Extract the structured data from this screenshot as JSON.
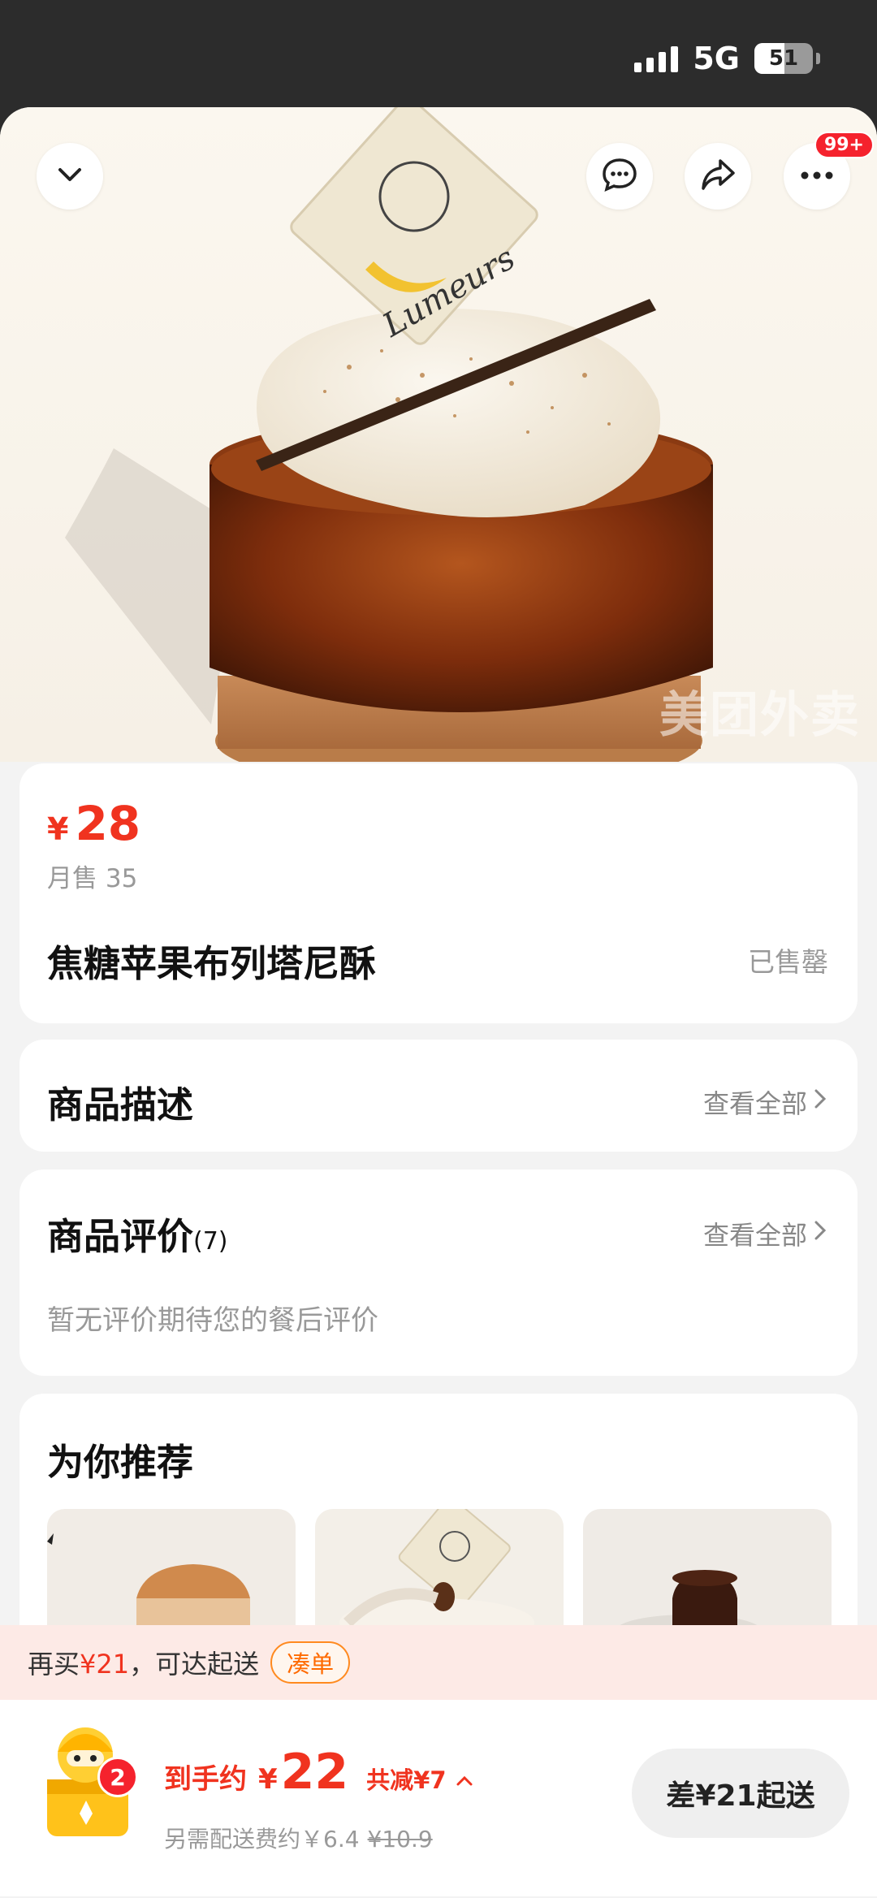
{
  "status_bar": {
    "network": "5G",
    "battery": "51",
    "battery_level": 0.51
  },
  "header": {
    "more_badge": "99+",
    "icons": [
      "chevron-down-icon",
      "chat-icon",
      "share-icon",
      "more-icon"
    ]
  },
  "hero": {
    "watermark": "美团外卖"
  },
  "product": {
    "price_symbol": "¥",
    "price": "28",
    "monthly_sales": "月售 35",
    "name": "焦糖苹果布列塔尼酥",
    "status": "已售罄"
  },
  "description_section": {
    "title": "商品描述",
    "see_all": "查看全部"
  },
  "reviews_section": {
    "title": "商品评价",
    "count": "(7)",
    "see_all": "查看全部",
    "empty_text": "暂无评价期待您的餐后评价"
  },
  "recommend_section": {
    "title": "为你推荐"
  },
  "min_order_bar": {
    "prefix": "再买",
    "amount": "¥21",
    "suffix": "，可达起送",
    "button": "凑单"
  },
  "cart": {
    "count": "2",
    "estimate_label": "到手约",
    "estimate_symbol": "¥",
    "estimate_price": "22",
    "discount": "共减¥7",
    "fee_text": "另需配送费约￥6.4",
    "original_price": "¥10.9",
    "checkout_label": "差¥21起送"
  },
  "colors": {
    "accent_red": "#f0331f",
    "orange": "#ff6a00",
    "bar_pink": "#fdeae6"
  }
}
